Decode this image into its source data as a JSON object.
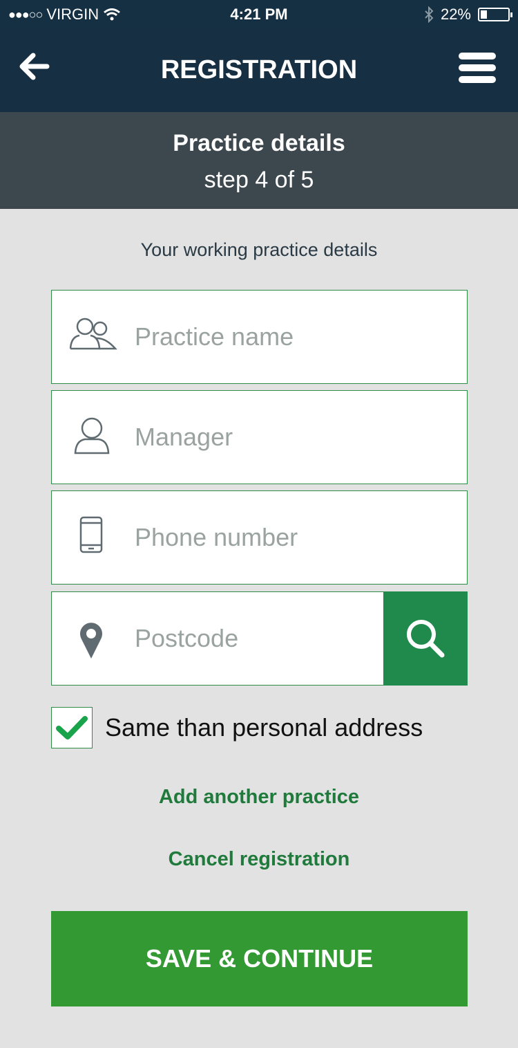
{
  "status_bar": {
    "carrier_signal": "●●●○○",
    "carrier": "VIRGIN",
    "time": "4:21 PM",
    "battery_percent": "22%",
    "battery_level": 0.22
  },
  "nav": {
    "title": "REGISTRATION",
    "back_icon": "arrow-left-icon",
    "menu_icon": "hamburger-menu-icon"
  },
  "step": {
    "heading": "Practice details",
    "progress": "step 4 of 5"
  },
  "form": {
    "intro": "Your working practice details",
    "practice_name": {
      "placeholder": "Practice name",
      "value": "",
      "icon": "people-icon"
    },
    "manager": {
      "placeholder": "Manager",
      "value": "",
      "icon": "person-icon"
    },
    "phone": {
      "placeholder": "Phone number",
      "value": "",
      "icon": "mobile-phone-icon"
    },
    "postcode": {
      "placeholder": "Postcode",
      "value": "",
      "icon": "location-pin-icon"
    },
    "same_address": {
      "label": "Same than personal address",
      "checked": true
    }
  },
  "links": {
    "add_practice": "Add another practice",
    "cancel": "Cancel registration"
  },
  "actions": {
    "save": "SAVE & CONTINUE"
  },
  "colors": {
    "header_bg": "#162f42",
    "step_bg": "#3c474e",
    "page_bg": "#e2e2e2",
    "accent_green": "#339933",
    "search_green": "#1f8a4b",
    "link_green": "#1f7a3c"
  }
}
